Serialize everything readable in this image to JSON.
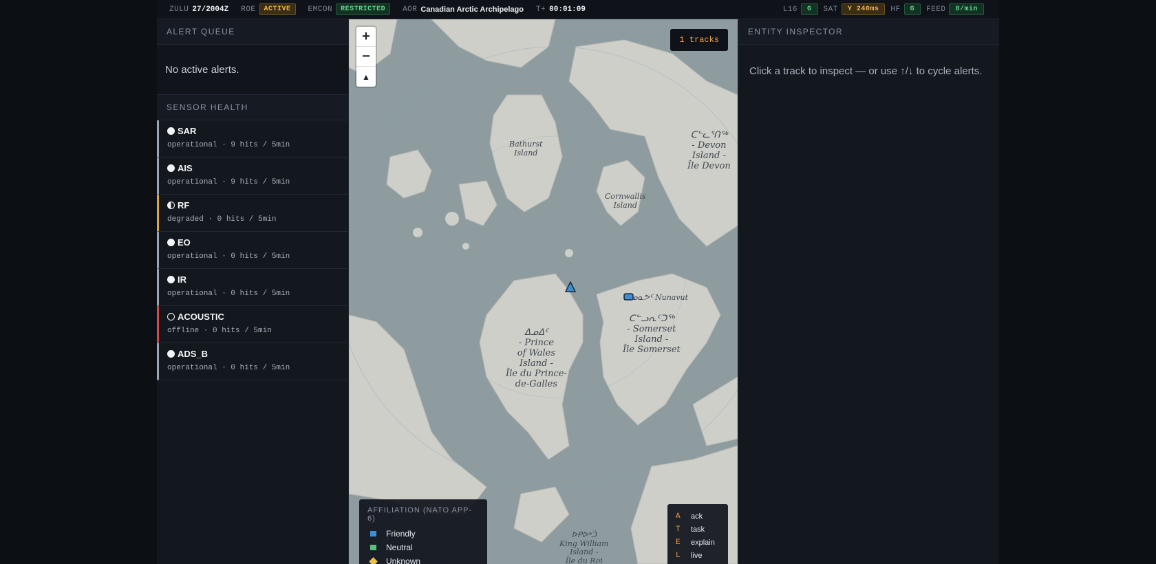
{
  "topbar": {
    "zulu_key": "ZULU",
    "zulu_val": "27/2004Z",
    "roe_key": "ROE",
    "roe_val": "ACTIVE",
    "emcon_key": "EMCON",
    "emcon_val": "RESTRICTED",
    "aor_key": "AOR",
    "aor_val": "Canadian Arctic Archipelago",
    "tplus_key": "T+",
    "tplus_val": "00:01:09",
    "l16_key": "L16",
    "l16_val": "G",
    "sat_key": "SAT",
    "sat_val": "Y 240ms",
    "hf_key": "HF",
    "hf_val": "G",
    "feed_key": "FEED",
    "feed_val": "8/min"
  },
  "alert_queue": {
    "title": "ALERT QUEUE",
    "empty_text": "No active alerts."
  },
  "sensor_health": {
    "title": "SENSOR HEALTH",
    "sensors": [
      {
        "name": "SAR",
        "status": "operational · 9 hits / 5min",
        "state": "ok"
      },
      {
        "name": "AIS",
        "status": "operational · 9 hits / 5min",
        "state": "ok"
      },
      {
        "name": "RF",
        "status": "degraded · 0 hits / 5min",
        "state": "warn"
      },
      {
        "name": "EO",
        "status": "operational · 0 hits / 5min",
        "state": "ok"
      },
      {
        "name": "IR",
        "status": "operational · 0 hits / 5min",
        "state": "ok"
      },
      {
        "name": "ACOUSTIC",
        "status": "offline · 0 hits / 5min",
        "state": "bad"
      },
      {
        "name": "ADS_B",
        "status": "operational · 0 hits / 5min",
        "state": "ok"
      }
    ]
  },
  "map": {
    "zoom_in": "+",
    "zoom_out": "−",
    "reset_north": "▲",
    "tracks_chip": "1 tracks",
    "labels": {
      "bathurst": "Bathurst\nIsland",
      "cornwallis": "Cornwallis\nIsland",
      "devon": "ᑕᓪᓚᕐᑎᖅ\n- Devon\nIsland -\nÎle Devon",
      "nunavut": "ᓄᓇᕗᑦ Nunavut",
      "somerset": "ᑕᓪᓗᕆᑦᑐᖅ\n- Somerset\nIsland -\nÎle Somerset",
      "prince_of_wales": "ᐃᓄᐃᑦ\n- Prince\nof Wales\nIsland -\nÎle du Prince-\nde-Galles",
      "king_william": "ᐅᑭᐅᒃᑑ\nKing William\nIsland -\nÎle du Roi"
    },
    "legend": {
      "title": "AFFILIATION (NATO APP-6)",
      "items": [
        {
          "label": "Friendly",
          "color": "#3b8fd6"
        },
        {
          "label": "Neutral",
          "color": "#5bbf7a"
        },
        {
          "label": "Unknown",
          "color": "#e8c24a"
        }
      ]
    },
    "hotkeys": [
      {
        "key": "A",
        "label": "ack"
      },
      {
        "key": "T",
        "label": "task"
      },
      {
        "key": "E",
        "label": "explain"
      },
      {
        "key": "L",
        "label": "live"
      }
    ]
  },
  "inspector": {
    "title": "ENTITY INSPECTOR",
    "hint": "Click a track to inspect — or use ↑/↓ to cycle alerts."
  }
}
